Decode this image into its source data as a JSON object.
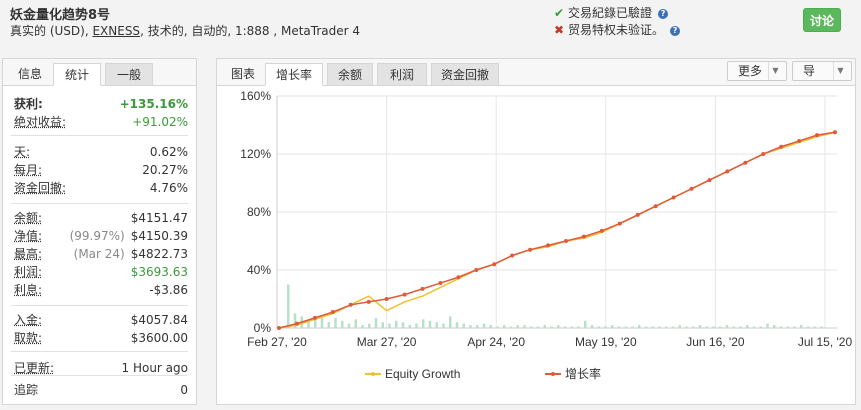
{
  "header": {
    "title": "妖金量化趋势8号",
    "subtitle_pre": "真实的 (USD), ",
    "subtitle_link": "EXNESS",
    "subtitle_post": ", 技术的, 自动的, 1:888 , MetaTrader 4",
    "verify_ok": "交易紀錄已驗證",
    "verify_fail": "贸易特权未验证。",
    "discuss_button": "讨论"
  },
  "left_tabs": {
    "label": "信息",
    "active": "统计",
    "inactive": "一般"
  },
  "stats": [
    {
      "key": "获利:",
      "value": "+135.16%"
    },
    {
      "key": "绝对收益:",
      "value": "+91.02%"
    },
    {
      "key": "天:",
      "value": "0.62%"
    },
    {
      "key": "每月:",
      "value": "20.27%"
    },
    {
      "key": "资金回撤:",
      "value": "4.76%"
    },
    {
      "key": "余额:",
      "value": "$4151.47"
    },
    {
      "key": "净值:",
      "pre": "(99.97%)",
      "value": "$4150.39"
    },
    {
      "key": "最高:",
      "pre": "(Mar 24)",
      "value": "$4822.73"
    },
    {
      "key": "利润:",
      "value": "$3693.63"
    },
    {
      "key": "利息:",
      "value": "-$3.86"
    },
    {
      "key": "入金:",
      "value": "$4057.84"
    },
    {
      "key": "取款:",
      "value": "$3600.00"
    },
    {
      "key": "已更新:",
      "value": "1 Hour ago"
    },
    {
      "key": "追踪",
      "value": "0"
    }
  ],
  "right_tabs": {
    "label": "图表",
    "items": [
      "增长率",
      "余额",
      "利润",
      "资金回撤"
    ],
    "more": "更多",
    "export": "导"
  },
  "colors": {
    "line": "#e05a3a",
    "equity": "#f0c030",
    "bars": "#b8e0c8",
    "grid": "#e6e6e6"
  },
  "chart_data": {
    "type": "line",
    "y_ticks": [
      "160%",
      "120%",
      "80%",
      "40%",
      "0%"
    ],
    "ylim": [
      0,
      160
    ],
    "x_ticks": [
      "Feb 27, '20",
      "Mar 27, '20",
      "Apr 24, '20",
      "May 19, '20",
      "Jun 16, '20",
      "Jul 15, '20"
    ],
    "series": [
      {
        "name": "Equity Growth",
        "values": [
          0,
          2,
          6,
          10,
          16,
          22,
          12,
          18,
          22,
          28,
          34,
          40,
          44,
          50,
          54,
          56,
          60,
          62,
          66,
          72,
          78,
          84,
          90,
          96,
          102,
          108,
          114,
          120,
          124,
          128,
          132,
          135
        ]
      },
      {
        "name": "增长率",
        "values": [
          0,
          3,
          7,
          11,
          16,
          18,
          20,
          23,
          27,
          31,
          35,
          40,
          44,
          50,
          54,
          57,
          60,
          63,
          67,
          72,
          78,
          84,
          90,
          96,
          102,
          108,
          114,
          120,
          125,
          129,
          133,
          135
        ]
      }
    ],
    "bars": [
      30,
      10,
      8,
      5,
      6,
      7,
      4,
      7,
      5,
      3,
      6,
      2,
      3,
      7,
      4,
      3,
      5,
      4,
      2,
      3,
      6,
      5,
      4,
      3,
      8,
      4,
      3,
      2,
      2,
      3,
      2,
      1,
      2,
      1,
      2,
      2,
      1,
      1,
      2,
      1,
      2,
      1,
      1,
      1,
      5,
      2,
      1,
      1,
      2,
      1,
      1,
      1,
      2,
      1,
      1,
      1,
      1,
      1,
      2,
      1,
      1,
      2,
      1,
      1,
      1,
      2,
      1,
      1,
      2,
      1,
      1,
      3,
      2,
      1,
      1,
      1,
      2,
      1,
      1,
      1
    ]
  }
}
